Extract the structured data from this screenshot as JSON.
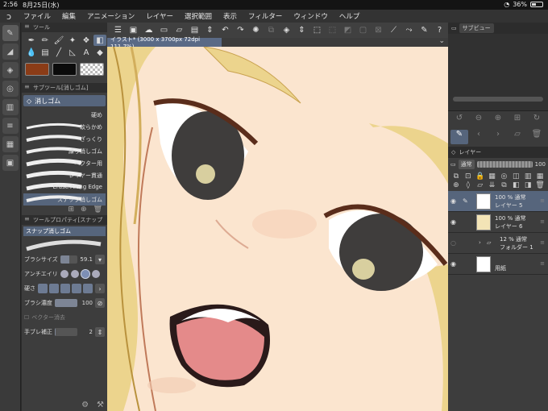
{
  "status": {
    "time": "2:56",
    "date": "8月25日(水)",
    "battery": "36%"
  },
  "menu": [
    "ファイル",
    "編集",
    "アニメーション",
    "レイヤー",
    "選択範囲",
    "表示",
    "フィルター",
    "ウィンドウ",
    "ヘルプ"
  ],
  "tool_panel": {
    "title": "ツール"
  },
  "subtool_panel": {
    "title": "サブツール[消しゴム]",
    "active": "消しゴム",
    "brushes": [
      "硬め",
      "軟らかめ",
      "ざっくり",
      "練り消しゴム",
      "ベクター用",
      "レイヤー貫通",
      "Erase Along Edge",
      "スナップ消しゴム"
    ],
    "selected_brush": "スナップ消しゴム"
  },
  "tool_property": {
    "title": "ツールプロパティ[スナップ",
    "subtitle": "スナップ消しゴム",
    "brush_size_label": "ブラシサイズ",
    "brush_size": "59.1",
    "antialias_label": "アンチエイリ",
    "hardness_label": "硬さ",
    "density_label": "ブラシ濃度",
    "density": "100",
    "vector_label": "ベクター消去",
    "stabilization_label": "手ブレ補正",
    "stabilization": "2"
  },
  "canvas": {
    "tab_title": "イラスト* (3000 x 3700px 72dpi 111.7%)"
  },
  "subview": {
    "title": "サブビュー"
  },
  "layer_panel": {
    "title": "レイヤー",
    "blend_mode": "通常",
    "opacity": "100",
    "layers": [
      {
        "line1": "100 % 通常",
        "line2": "レイヤー 5",
        "selected": true
      },
      {
        "line1": "100 % 通常",
        "line2": "レイヤー 6",
        "selected": false
      },
      {
        "line1": "12 % 通常",
        "line2": "フォルダー 1",
        "selected": false,
        "folder": true
      },
      {
        "line1": "",
        "line2": "用紙",
        "selected": false
      }
    ]
  },
  "colors": {
    "main": "#8b3c17",
    "sub": "#0b0b0b",
    "accent": "#56657c"
  }
}
